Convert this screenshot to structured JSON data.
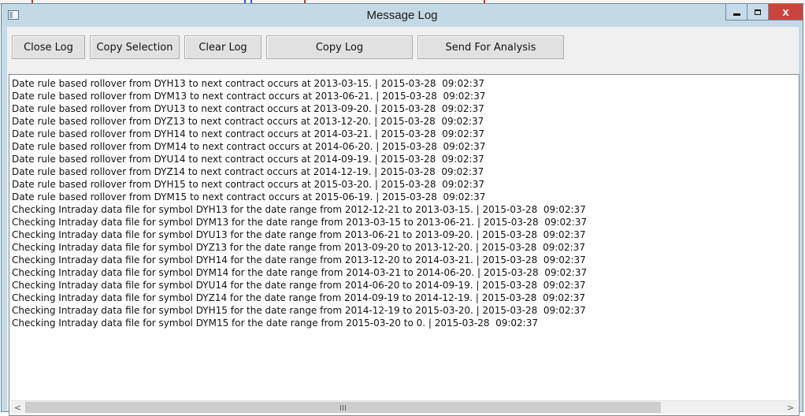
{
  "window": {
    "title": "Message Log",
    "close_glyph": "x"
  },
  "toolbar": {
    "close_log": "Close Log",
    "copy_selection": "Copy Selection",
    "clear_log": "Clear Log",
    "copy_log": "Copy Log",
    "send_for_analysis": "Send For Analysis"
  },
  "log": {
    "lines": [
      "Date rule based rollover from DYH13 to next contract occurs at 2013-03-15. | 2015-03-28  09:02:37",
      "Date rule based rollover from DYM13 to next contract occurs at 2013-06-21. | 2015-03-28  09:02:37",
      "Date rule based rollover from DYU13 to next contract occurs at 2013-09-20. | 2015-03-28  09:02:37",
      "Date rule based rollover from DYZ13 to next contract occurs at 2013-12-20. | 2015-03-28  09:02:37",
      "Date rule based rollover from DYH14 to next contract occurs at 2014-03-21. | 2015-03-28  09:02:37",
      "Date rule based rollover from DYM14 to next contract occurs at 2014-06-20. | 2015-03-28  09:02:37",
      "Date rule based rollover from DYU14 to next contract occurs at 2014-09-19. | 2015-03-28  09:02:37",
      "Date rule based rollover from DYZ14 to next contract occurs at 2014-12-19. | 2015-03-28  09:02:37",
      "Date rule based rollover from DYH15 to next contract occurs at 2015-03-20. | 2015-03-28  09:02:37",
      "Date rule based rollover from DYM15 to next contract occurs at 2015-06-19. | 2015-03-28  09:02:37",
      "Checking Intraday data file for symbol DYH13 for the date range from 2012-12-21 to 2013-03-15. | 2015-03-28  09:02:37",
      "Checking Intraday data file for symbol DYM13 for the date range from 2013-03-15 to 2013-06-21. | 2015-03-28  09:02:37",
      "Checking Intraday data file for symbol DYU13 for the date range from 2013-06-21 to 2013-09-20. | 2015-03-28  09:02:37",
      "Checking Intraday data file for symbol DYZ13 for the date range from 2013-09-20 to 2013-12-20. | 2015-03-28  09:02:37",
      "Checking Intraday data file for symbol DYH14 for the date range from 2013-12-20 to 2014-03-21. | 2015-03-28  09:02:37",
      "Checking Intraday data file for symbol DYM14 for the date range from 2014-03-21 to 2014-06-20. | 2015-03-28  09:02:37",
      "Checking Intraday data file for symbol DYU14 for the date range from 2014-06-20 to 2014-09-19. | 2015-03-28  09:02:37",
      "Checking Intraday data file for symbol DYZ14 for the date range from 2014-09-19 to 2014-12-19. | 2015-03-28  09:02:37",
      "Checking Intraday data file for symbol DYH15 for the date range from 2014-12-19 to 2015-03-20. | 2015-03-28  09:02:37",
      "Checking Intraday data file for symbol DYM15 for the date range from 2015-03-20 to 0. | 2015-03-28  09:02:37"
    ]
  },
  "scrollbar": {
    "left_arrow": "<",
    "right_arrow": ">"
  },
  "colors": {
    "titlebar": "#c3d9e6",
    "close_button": "#c9443d",
    "client_background": "#f0f0f0"
  }
}
